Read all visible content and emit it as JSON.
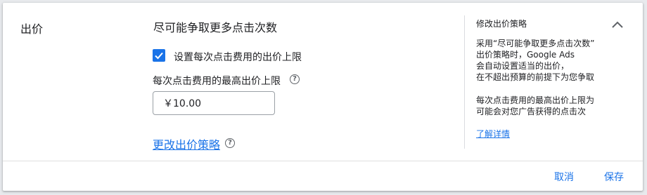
{
  "section": {
    "title": "出价"
  },
  "strategy": {
    "title": "尽可能争取更多点击次数",
    "checkbox_label": "设置每次点击费用的出价上限",
    "checkbox_checked": true,
    "max_cpc_label": "每次点击费用的最高出价上限",
    "max_cpc_value": "￥10.00",
    "change_link": "更改出价策略"
  },
  "side_panel": {
    "title": "修改出价策略",
    "para1": [
      "采用“尽可能争取更多点击次数”",
      "出价策略时，Google Ads",
      "会自动设置适当的出价，",
      "在不超出预算的前提下为您争取"
    ],
    "para2": [
      "每次点击费用的最高出价上限为",
      "可能会对您广告获得的点击次"
    ],
    "learn_more": "了解详情"
  },
  "icons": {
    "help": "help-circle-icon",
    "collapse": "chevron-up-icon",
    "check": "check-icon"
  },
  "footer": {
    "cancel_label": "取消",
    "save_label": "保存"
  },
  "colors": {
    "accent": "#1a73e8",
    "text": "#202124",
    "divider": "#dadce0"
  }
}
